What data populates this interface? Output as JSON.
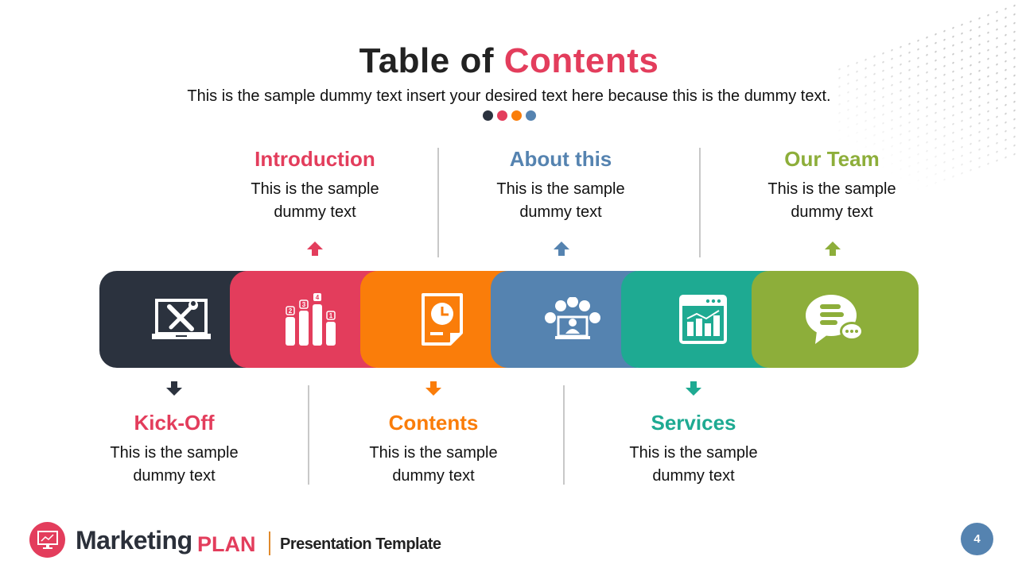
{
  "header": {
    "title_part1": "Table of",
    "title_part2": "Contents",
    "subtitle": "This is the sample dummy  text insert your desired text here because this is the dummy  text."
  },
  "colors": {
    "dark": "#2b323e",
    "red": "#e33d5c",
    "orange": "#fa7d0a",
    "blue": "#5583b0",
    "teal": "#1eaa92",
    "green": "#8dae3a"
  },
  "indicator_dots": [
    "#2b323e",
    "#e33d5c",
    "#fa7d0a",
    "#5583b0"
  ],
  "sections": [
    {
      "id": "kickoff",
      "title": "Kick-Off",
      "line1": "This is the sample",
      "line2": "dummy  text",
      "color": "#e33d5c",
      "icon": "laptop-tools-icon"
    },
    {
      "id": "introduction",
      "title": "Introduction",
      "line1": "This is the sample",
      "line2": "dummy  text",
      "color": "#e33d5c",
      "icon": "ranking-bars-icon"
    },
    {
      "id": "contents",
      "title": "Contents",
      "line1": "This is the sample",
      "line2": "dummy  text",
      "color": "#fa7d0a",
      "icon": "document-clock-icon"
    },
    {
      "id": "about",
      "title": "About this",
      "line1": "This is the sample",
      "line2": "dummy  text",
      "color": "#5583b0",
      "icon": "network-people-icon"
    },
    {
      "id": "services",
      "title": "Services",
      "line1": "This is the sample",
      "line2": "dummy  text",
      "color": "#1eaa92",
      "icon": "browser-chart-icon"
    },
    {
      "id": "team",
      "title": "Our Team",
      "line1": "This is the sample",
      "line2": "dummy  text",
      "color": "#8dae3a",
      "icon": "chat-bubble-icon"
    }
  ],
  "footer": {
    "brand_main": "Marketing",
    "brand_accent": "PLAN",
    "brand_tagline": "Presentation Template",
    "page_number": "4"
  }
}
